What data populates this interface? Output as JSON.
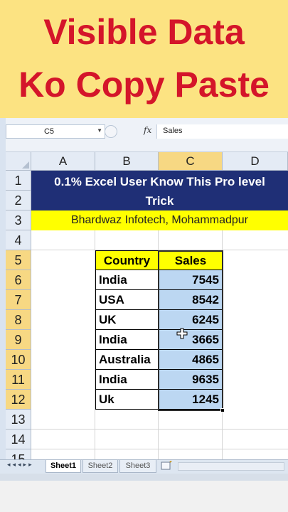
{
  "banner": {
    "line1": "Visible Data",
    "line2": "Ko Copy Paste",
    "text_color": "#d4152a",
    "background": "#fce382"
  },
  "formula_bar": {
    "name_box": "C5",
    "fx_label": "fx",
    "formula_value": "Sales"
  },
  "grid": {
    "columns": [
      "A",
      "B",
      "C",
      "D"
    ],
    "selected_column": "C",
    "rows": [
      "1",
      "2",
      "3",
      "4",
      "5",
      "6",
      "7",
      "8",
      "9",
      "10",
      "11",
      "12",
      "13",
      "14",
      "15"
    ],
    "title": "0.1% Excel User Know This Pro level Trick",
    "title_line1": "0.1% Excel User Know This Pro level",
    "title_line2": "Trick",
    "subtitle": "Bhardwaz Infotech, Mohammadpur",
    "table": {
      "headers": [
        "Country",
        "Sales"
      ],
      "rows": [
        [
          "India",
          "7545"
        ],
        [
          "USA",
          "8542"
        ],
        [
          "UK",
          "6245"
        ],
        [
          "India",
          "3665"
        ],
        [
          "Australia",
          "4865"
        ],
        [
          "India",
          "9635"
        ],
        [
          "Uk",
          "1245"
        ]
      ]
    }
  },
  "sheets": {
    "tabs": [
      "Sheet1",
      "Sheet2",
      "Sheet3"
    ],
    "active": "Sheet1"
  },
  "colors": {
    "title_band": "#1f2f76",
    "subtitle_band": "#ffff00",
    "header_fill": "#ffff00",
    "selection_fill": "#bcd7f2",
    "selected_header": "#f7d883"
  }
}
